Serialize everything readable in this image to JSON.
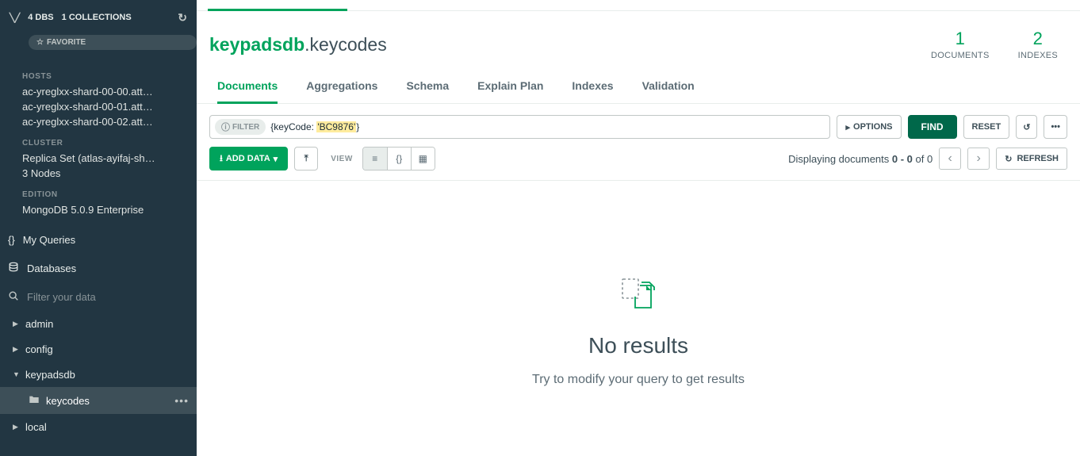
{
  "sidebar": {
    "dbs_count": "4 DBS",
    "coll_count": "1 COLLECTIONS",
    "favorite": "FAVORITE",
    "hosts_label": "HOSTS",
    "hosts": [
      "ac-yreglxx-shard-00-00.att…",
      "ac-yreglxx-shard-00-01.att…",
      "ac-yreglxx-shard-00-02.att…"
    ],
    "cluster_label": "CLUSTER",
    "cluster_name": "Replica Set (atlas-ayifaj-sh…",
    "cluster_nodes": "3 Nodes",
    "edition_label": "EDITION",
    "edition_value": "MongoDB 5.0.9 Enterprise",
    "nav": {
      "my_queries": "My Queries",
      "databases": "Databases"
    },
    "search_placeholder": "Filter your data",
    "dbs": [
      {
        "name": "admin",
        "expanded": false
      },
      {
        "name": "config",
        "expanded": false
      },
      {
        "name": "keypadsdb",
        "expanded": true,
        "collections": [
          "keycodes"
        ]
      },
      {
        "name": "local",
        "expanded": false
      }
    ]
  },
  "header": {
    "db": "keypadsdb",
    "collection": "keycodes",
    "stats": [
      {
        "value": "1",
        "label": "DOCUMENTS"
      },
      {
        "value": "2",
        "label": "INDEXES"
      }
    ]
  },
  "tabs": [
    "Documents",
    "Aggregations",
    "Schema",
    "Explain Plan",
    "Indexes",
    "Validation"
  ],
  "active_tab": 0,
  "query": {
    "filter_label": "FILTER",
    "prefix": "{keyCode: ",
    "highlight": "'BC9876'",
    "suffix": "}",
    "options": "OPTIONS",
    "find": "FIND",
    "reset": "RESET"
  },
  "toolbar": {
    "add_data": "ADD DATA",
    "view_label": "VIEW",
    "display_prefix": "Displaying documents ",
    "display_range": "0 - 0",
    "display_of": " of ",
    "display_total": "0",
    "refresh": "REFRESH"
  },
  "empty": {
    "title": "No results",
    "subtitle": "Try to modify your query to get results"
  }
}
